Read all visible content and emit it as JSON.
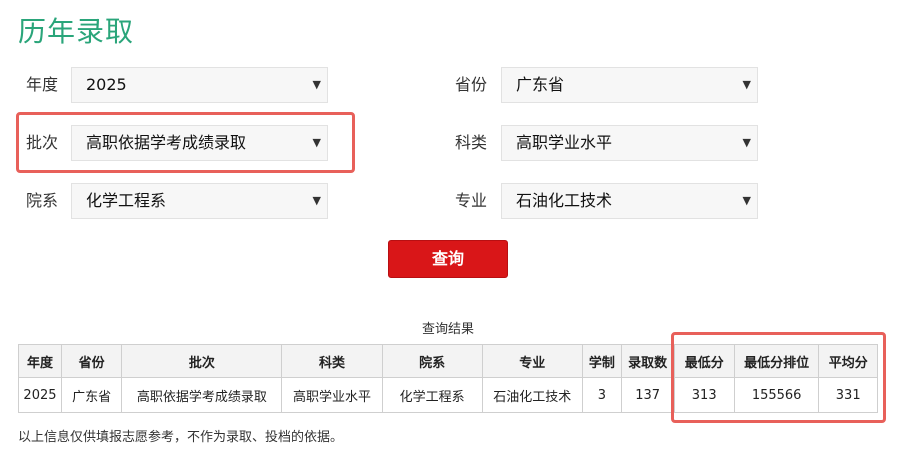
{
  "page": {
    "title": "历年录取"
  },
  "form": {
    "year": {
      "label": "年度",
      "value": "2025"
    },
    "province": {
      "label": "省份",
      "value": "广东省"
    },
    "batch": {
      "label": "批次",
      "value": "高职依据学考成绩录取"
    },
    "subject_type": {
      "label": "科类",
      "value": "高职学业水平"
    },
    "department": {
      "label": "院系",
      "value": "化学工程系"
    },
    "major": {
      "label": "专业",
      "value": "石油化工技术"
    }
  },
  "query_button": {
    "label": "查询"
  },
  "results": {
    "caption": "查询结果",
    "headers": [
      "年度",
      "省份",
      "批次",
      "科类",
      "院系",
      "专业",
      "学制",
      "录取数",
      "最低分",
      "最低分排位",
      "平均分"
    ],
    "rows": [
      [
        "2025",
        "广东省",
        "高职依据学考成绩录取",
        "高职学业水平",
        "化学工程系",
        "石油化工技术",
        "3",
        "137",
        "313",
        "155566",
        "331"
      ]
    ]
  },
  "note": "以上信息仅供填报志愿参考，不作为录取、投档的依据。",
  "colors": {
    "title": "#2aa57a",
    "button": "#d91618",
    "highlight": "#e8605a"
  }
}
